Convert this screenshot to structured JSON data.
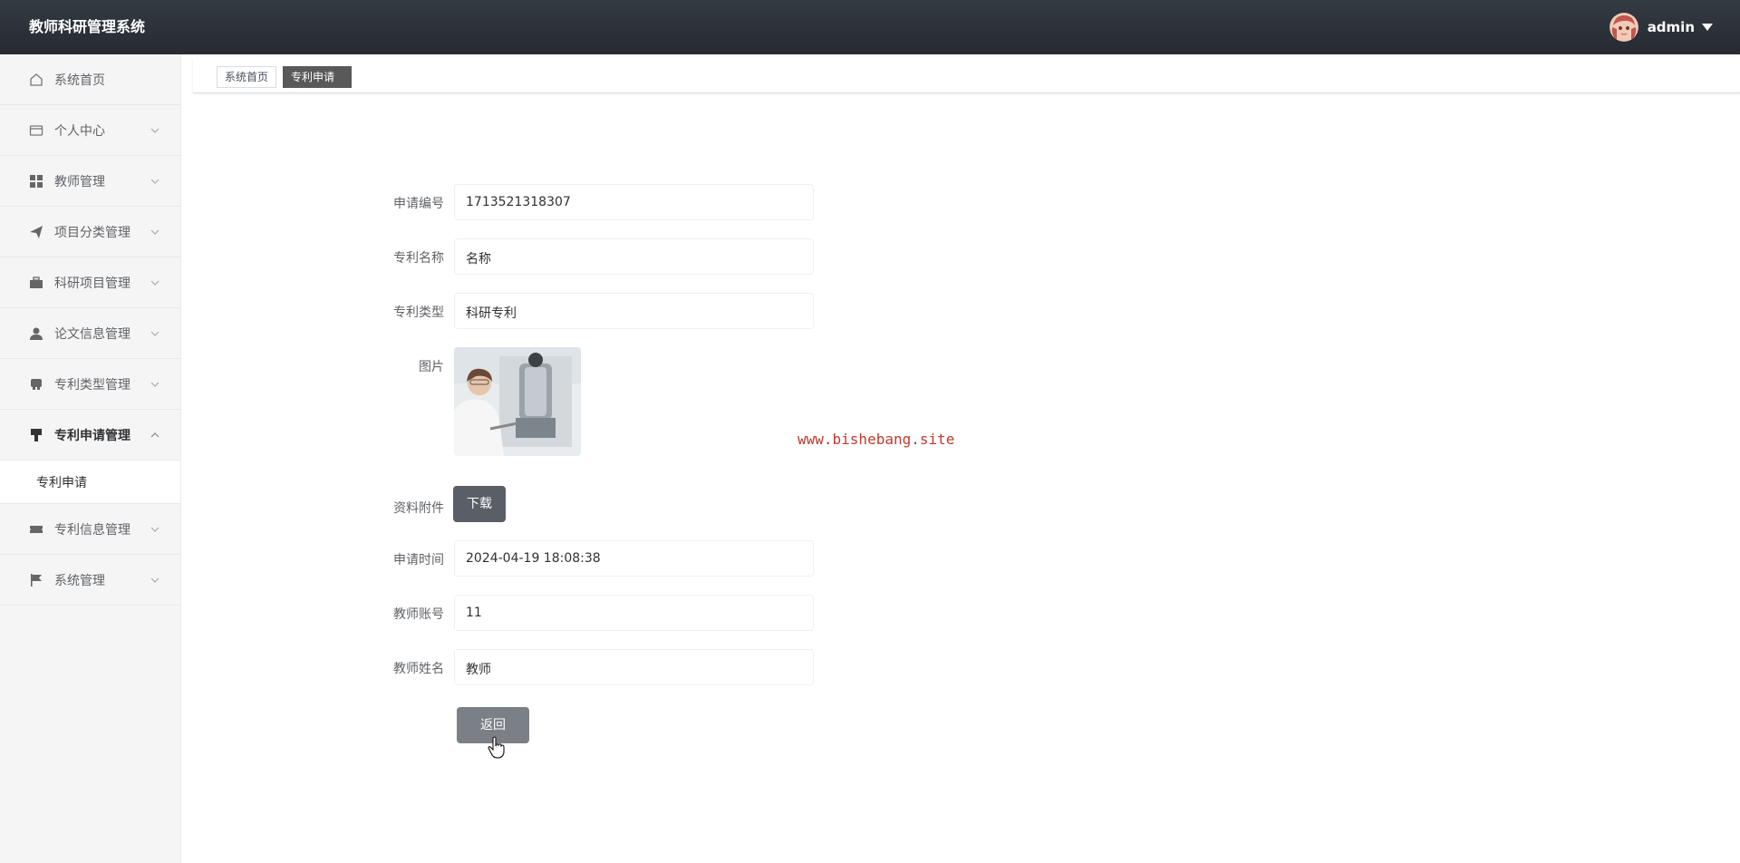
{
  "app": {
    "title": "教师科研管理系统"
  },
  "user": {
    "name": "admin"
  },
  "sidebar": {
    "items": [
      {
        "label": "系统首页",
        "icon": "home-icon",
        "has_children": false
      },
      {
        "label": "个人中心",
        "icon": "card-icon",
        "has_children": true
      },
      {
        "label": "教师管理",
        "icon": "grid-icon",
        "has_children": true
      },
      {
        "label": "项目分类管理",
        "icon": "paper-plane-icon",
        "has_children": true
      },
      {
        "label": "科研项目管理",
        "icon": "briefcase-icon",
        "has_children": true
      },
      {
        "label": "论文信息管理",
        "icon": "user-icon",
        "has_children": true
      },
      {
        "label": "专利类型管理",
        "icon": "printer-icon",
        "has_children": true
      },
      {
        "label": "专利申请管理",
        "icon": "brush-icon",
        "has_children": true,
        "expanded": true
      },
      {
        "label": "专利信息管理",
        "icon": "ticket-icon",
        "has_children": true
      },
      {
        "label": "系统管理",
        "icon": "flag-icon",
        "has_children": true
      }
    ],
    "submenu": {
      "label": "专利申请"
    }
  },
  "tabs": [
    {
      "label": "系统首页",
      "active": false
    },
    {
      "label": "专利申请×",
      "active": true
    }
  ],
  "form": {
    "application_no": {
      "label": "申请编号",
      "value": "1713521318307"
    },
    "patent_name": {
      "label": "专利名称",
      "value": "名称"
    },
    "patent_type": {
      "label": "专利类型",
      "value": "科研专利"
    },
    "image": {
      "label": "图片",
      "alt": "scientist-photo"
    },
    "attachment": {
      "label": "资料附件",
      "button": "下载"
    },
    "apply_time": {
      "label": "申请时间",
      "value": "2024-04-19 18:08:38"
    },
    "teacher_account": {
      "label": "教师账号",
      "value": "11"
    },
    "teacher_name": {
      "label": "教师姓名",
      "value": "教师"
    },
    "back_button": "返回"
  },
  "watermark": "www.bishebang.site",
  "colors": {
    "header": "#2b3138",
    "active_tab": "#595959",
    "button": "#5a5e66",
    "watermark": "#c0392b"
  }
}
